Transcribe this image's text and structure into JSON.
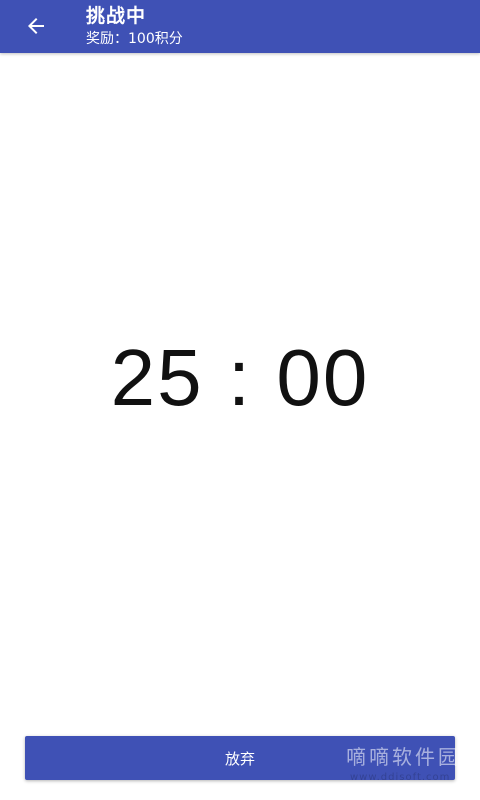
{
  "toolbar": {
    "back_icon": "arrow-left-icon",
    "title": "挑战中",
    "subtitle": "奖励：100积分"
  },
  "timer": {
    "display": "25 : 00"
  },
  "actions": {
    "give_up_label": "放弃"
  },
  "watermark": {
    "text": "嘀嘀软件园",
    "url": "www.ddisoft.com"
  },
  "colors": {
    "primary": "#3f51b5",
    "background": "#ffffff",
    "timer_text": "#111111"
  }
}
